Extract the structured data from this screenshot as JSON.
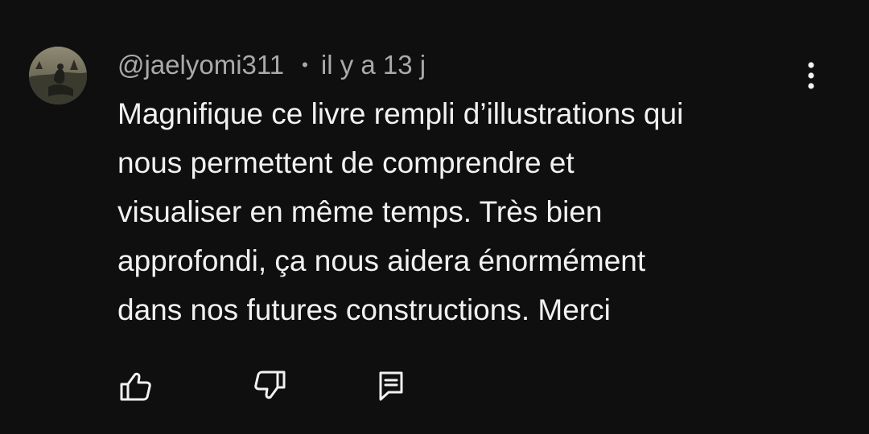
{
  "comment": {
    "author": "@jaelyomi311",
    "separator": "•",
    "time": "il y a 13 j",
    "text": "Magnifique ce livre rempli d’illustrations qui\nnous permettent de comprendre et\nvisualiser en même temps. Très bien\napprofondi, ça nous aidera énormément\ndans nos futures constructions. Merci"
  },
  "icons": {
    "avatar": "avatar",
    "menu": "more-vertical-icon",
    "like": "thumb-up-icon",
    "dislike": "thumb-down-icon",
    "reply": "reply-comment-icon"
  },
  "colors": {
    "background": "#0f0f0f",
    "primary_text": "#f1f1f1",
    "secondary_text": "#aaaaaa"
  }
}
